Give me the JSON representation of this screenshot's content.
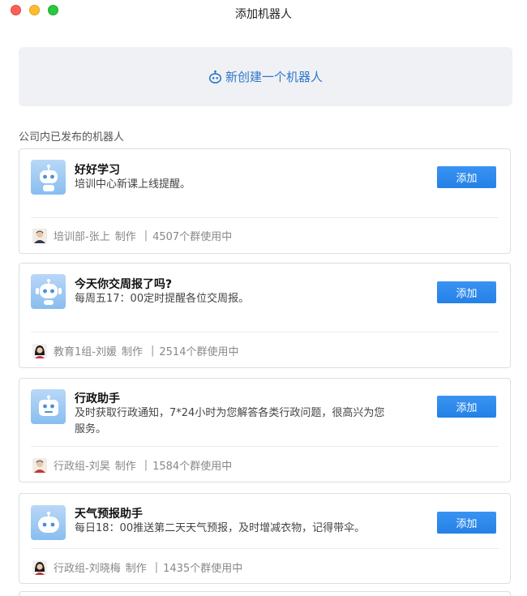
{
  "window": {
    "title": "添加机器人"
  },
  "create": {
    "label": "新创建一个机器人"
  },
  "section": {
    "label": "公司内已发布的机器人"
  },
  "colors": {
    "accent": "#2e77c9",
    "button": "#2481e6",
    "avatar_bg": "#9cc9f2"
  },
  "bots": [
    {
      "name": "好好学习",
      "desc": "培训中心新课上线提醒。",
      "button": "添加",
      "author": "培训部-张上",
      "made": "制作",
      "usage": "4507个群使用中",
      "user_icon": "male-user-icon"
    },
    {
      "name": "今天你交周报了吗?",
      "desc": "每周五17：00定时提醒各位交周报。",
      "button": "添加",
      "author": "教育1组-刘媛",
      "made": "制作",
      "usage": "2514个群使用中",
      "user_icon": "female-user-icon"
    },
    {
      "name": "行政助手",
      "desc": "及时获取行政通知，7*24小时为您解答各类行政问题，很高兴为您服务。",
      "button": "添加",
      "author": "行政组-刘昊",
      "made": "制作",
      "usage": "1584个群使用中",
      "user_icon": "male-user-icon"
    },
    {
      "name": "天气预报助手",
      "desc": "每日18：00推送第二天天气预报，及时增减衣物，记得带伞。",
      "button": "添加",
      "author": "行政组-刘晓梅",
      "made": "制作",
      "usage": "1435个群使用中",
      "user_icon": "female-user-icon"
    }
  ]
}
